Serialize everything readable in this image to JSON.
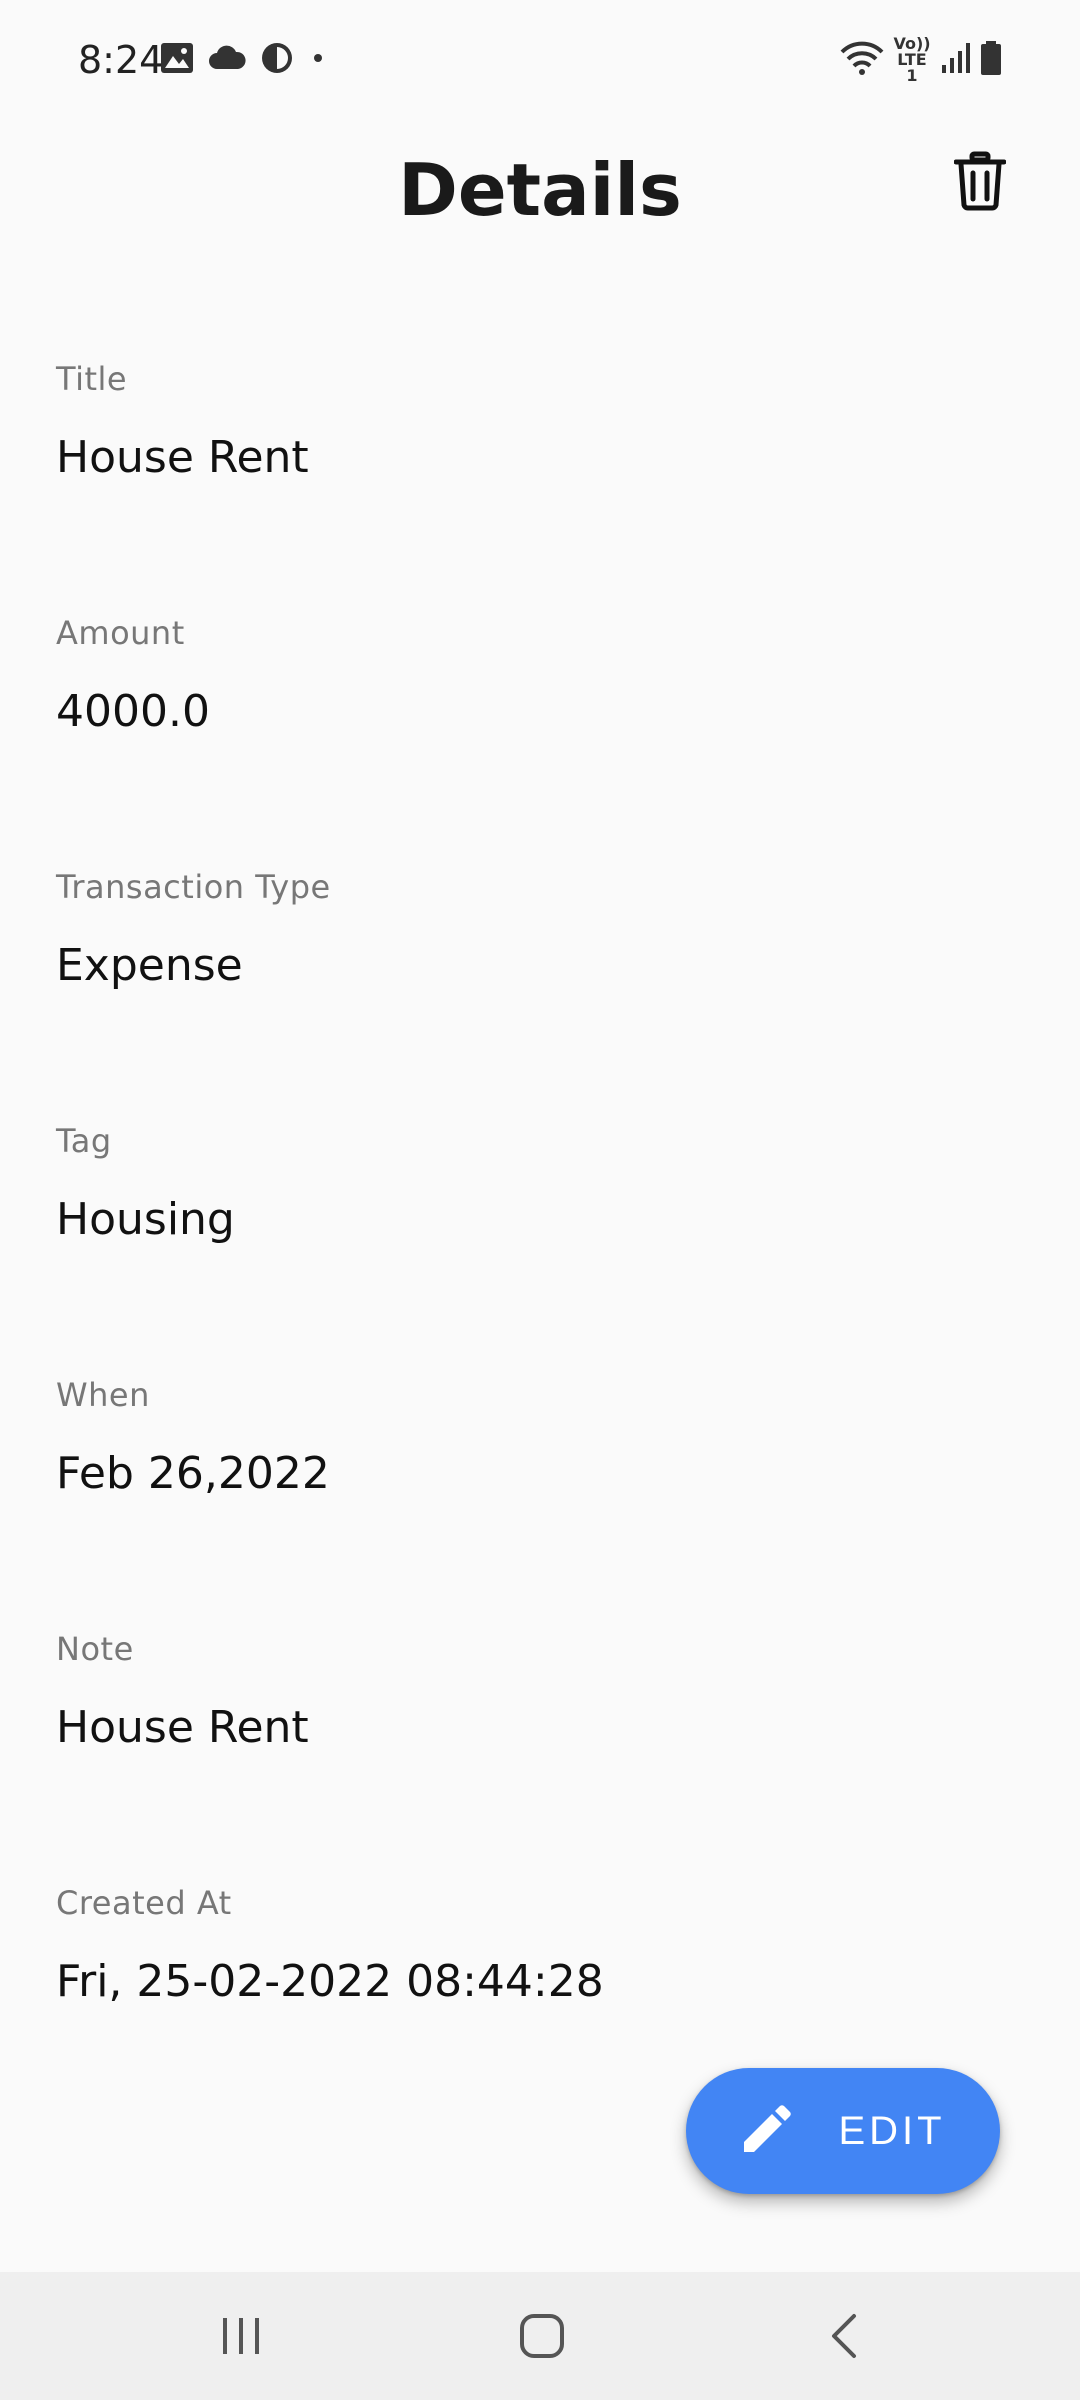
{
  "status_bar": {
    "time": "8:24",
    "network_label": "Vo)) LTE1"
  },
  "header": {
    "title": "Details"
  },
  "fields": [
    {
      "label": "Title",
      "value": "House Rent"
    },
    {
      "label": "Amount",
      "value": "4000.0"
    },
    {
      "label": "Transaction Type",
      "value": "Expense"
    },
    {
      "label": "Tag",
      "value": "Housing"
    },
    {
      "label": "When",
      "value": "Feb 26,2022"
    },
    {
      "label": "Note",
      "value": "House Rent"
    },
    {
      "label": "Created At",
      "value": "Fri, 25-02-2022 08:44:28"
    }
  ],
  "fab": {
    "label": "EDIT"
  },
  "colors": {
    "accent": "#4285f4",
    "background": "#fafafa",
    "label": "#777777",
    "value": "#111111"
  },
  "icons": {
    "delete": "trash-icon",
    "edit": "pencil-icon",
    "nav_recents": "recents-icon",
    "nav_home": "home-icon",
    "nav_back": "back-icon"
  }
}
